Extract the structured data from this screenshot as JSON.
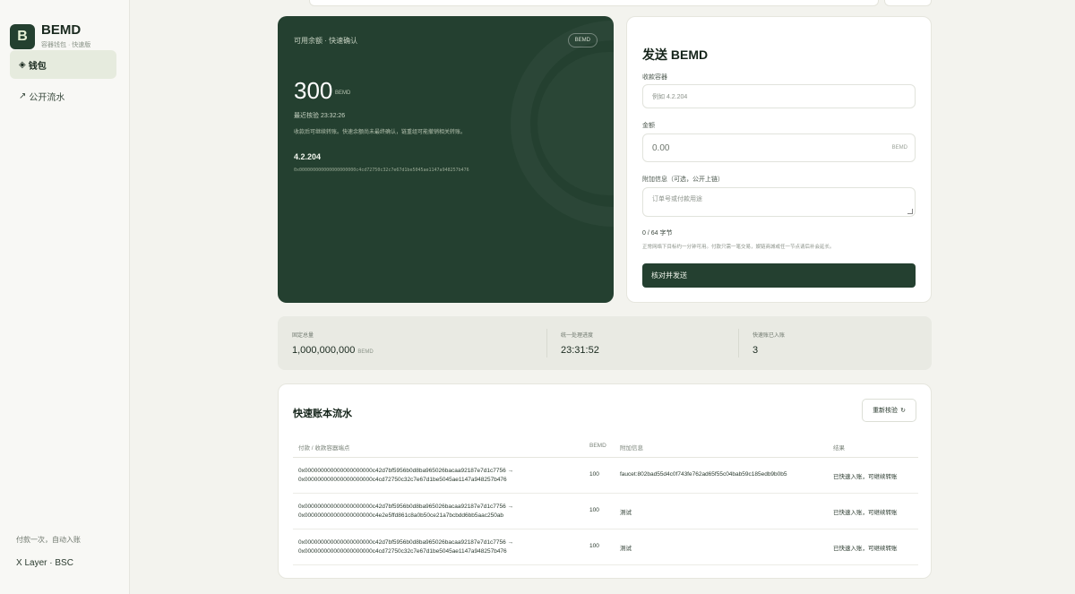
{
  "sidebar": {
    "logo_letter": "B",
    "brand": "BEMD",
    "brand_sub": "容器钱包 · 快速版",
    "nav": [
      {
        "icon": "◈",
        "label": "钱包"
      },
      {
        "icon": "↗",
        "label": "公开流水"
      }
    ],
    "footer_note": "付款一次，自动入账",
    "footer_network": "X Layer · BSC"
  },
  "balance": {
    "label": "可用余额 · 快速确认",
    "badge": "BEMD",
    "amount": "300",
    "unit": "BEMD",
    "last_check": "最近核验 23:32:26",
    "note": "收款后可继续转账。快速余额尚未最终确认，链重组可能撤销相关转账。",
    "container_ip": "4.2.204",
    "address": "0x000000000000000000000c4cd72750c32c7e67d1be5045ae1147a948257b476"
  },
  "send": {
    "title": "发送 BEMD",
    "recipient_label": "收款容器",
    "recipient_placeholder": "例如 4.2.204",
    "amount_label": "金额",
    "amount_value": "0.00",
    "amount_unit": "BEMD",
    "memo_label": "附加信息（可选，公开上链）",
    "memo_placeholder": "订单号或付款用途",
    "bytes": "0 / 64 字节",
    "hint": "正常网络下目标约一分钟可用。付款只需一笔交易，娱链商城或任一节点请后补会延长。",
    "button": "核对并发送"
  },
  "stats": [
    {
      "label": "固定总量",
      "value": "1,000,000,000",
      "unit": "BEMD"
    },
    {
      "label": "统一处理进度",
      "value": "23:31:52",
      "unit": ""
    },
    {
      "label": "快速账已入账",
      "value": "3",
      "unit": ""
    }
  ],
  "ledger": {
    "title": "快速账本流水",
    "refresh_label": "重新核验",
    "refresh_icon": "↻",
    "columns": [
      "付款 / 收款容器端点",
      "BEMD",
      "附加信息",
      "结果"
    ],
    "rows": [
      {
        "from": "0x000000000000000000000c42d7bf5956b0d8ba965026bacaa92187e7d1c7756 →",
        "to": "0x000000000000000000000c4cd72750c32c7e67d1be5045ae1147a948257b476",
        "amount": "100",
        "memo": "faucet:802bad55d4c0f743fe762ad65f55c04bab59c185edb9b0b5",
        "result": "已快速入账，可继续转账"
      },
      {
        "from": "0x000000000000000000000c42d7bf5956b0d8ba965026bacaa92187e7d1c7756 →",
        "to": "0x000000000000000000000c4e2e5ffd861c8a0b50ce21a7bcbdd6bb5aac250ab",
        "amount": "100",
        "memo": "测试",
        "result": "已快速入账，可继续转账"
      },
      {
        "from": "0x000000000000000000000c42d7bf5956b0d8ba965026bacaa92187e7d1c7756 →",
        "to": "0x000000000000000000000c4cd72750c32c7e67d1be5045ae1147a948257b476",
        "amount": "100",
        "memo": "测试",
        "result": "已快速入账，可继续转账"
      }
    ]
  }
}
